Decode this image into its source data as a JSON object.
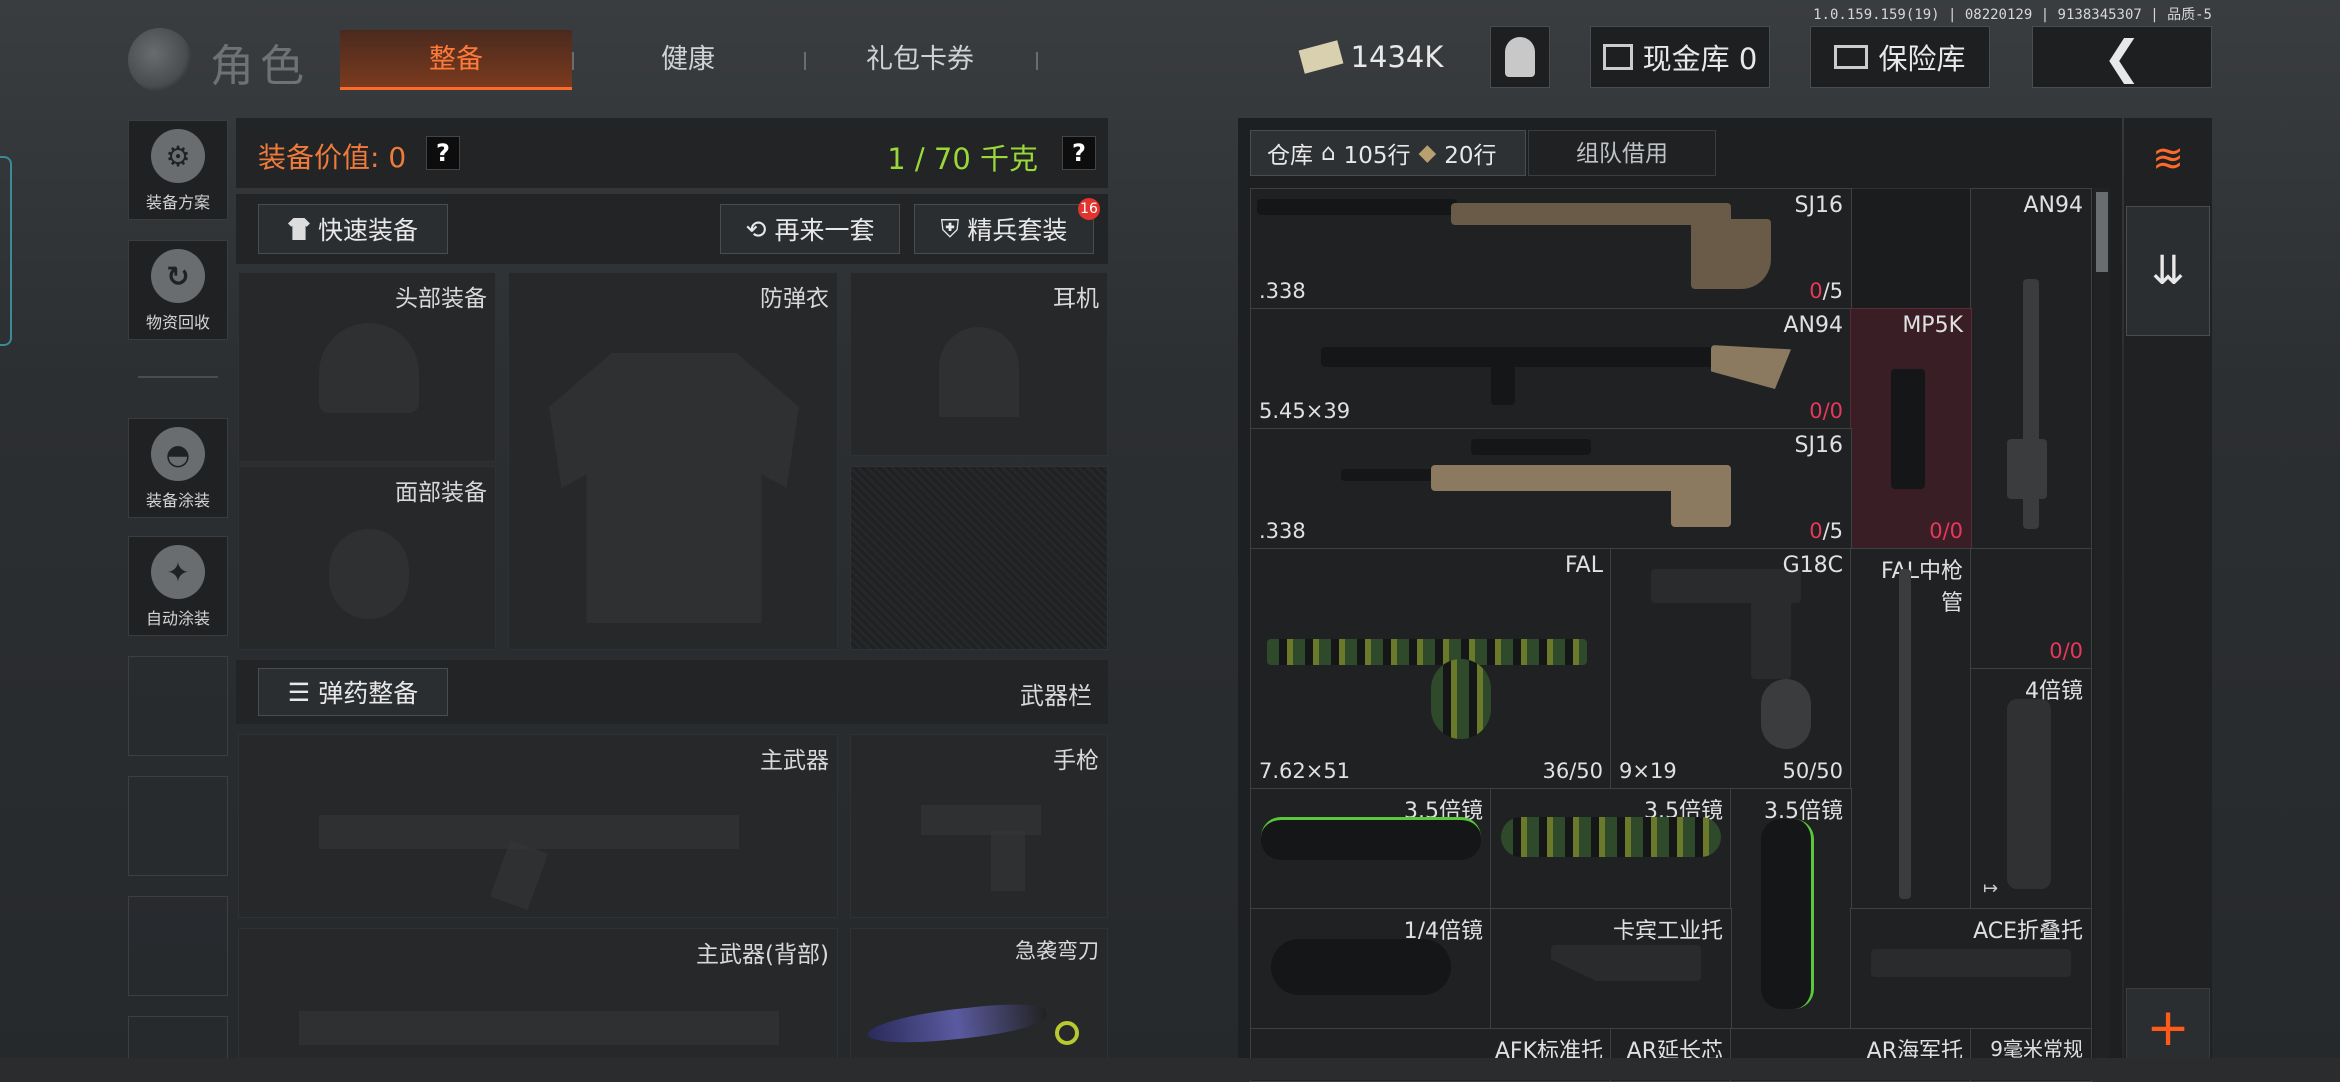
{
  "header": {
    "version": "1.0.159.159(19) | 08220129 | 9138345307 | 品质-5",
    "title": "角色",
    "tabs": [
      {
        "label": "整备",
        "active": true
      },
      {
        "label": "健康"
      },
      {
        "label": "礼包卡券"
      }
    ],
    "money": "1434K",
    "cash_vault": "现金库 0",
    "safe_box": "保险库",
    "icons": {
      "money": "cash-icon",
      "profile": "operator-icon",
      "cash_vault": "vault-icon",
      "safe_box": "safebox-icon",
      "back": "back-arrow-icon"
    }
  },
  "sidebar": {
    "items": [
      {
        "label": "装备方案",
        "icon": "loadout-plan-icon"
      },
      {
        "label": "物资回收",
        "icon": "recycle-icon"
      },
      {
        "label": "装备涂装",
        "icon": "helmet-paint-icon"
      },
      {
        "label": "自动涂装",
        "icon": "auto-paint-icon"
      }
    ]
  },
  "loadout": {
    "value_label": "装备价值: 0",
    "weight": "1 / 70 千克",
    "quick_equip": "快速装备",
    "again": "再来一套",
    "elite": "精兵套装",
    "elite_badge": "16",
    "slots": {
      "head": "头部装备",
      "armor": "防弹衣",
      "headset": "耳机",
      "face": "面部装备",
      "ammo_btn": "弹药整备",
      "weapons_bar": "武器栏",
      "primary": "主武器",
      "pistol": "手枪",
      "primary_back": "主武器(背部)",
      "knife": "急袭弯刀"
    }
  },
  "warehouse": {
    "tab_label": "仓库",
    "rows_home": "105行",
    "rows_bag": "20行",
    "team_borrow": "组队借用",
    "items": [
      {
        "id": "sj16a",
        "name": "SJ16",
        "cal": ".338",
        "count": "0/5",
        "count_red": "0"
      },
      {
        "id": "an94top",
        "name": "AN94"
      },
      {
        "id": "an94",
        "name": "AN94",
        "cal": "5.45×39",
        "count": "0/0",
        "count_red": "0/0"
      },
      {
        "id": "mp5k",
        "name": "MP5K",
        "count": "0/0",
        "count_red": "0/0"
      },
      {
        "id": "sj16b",
        "name": "SJ16",
        "cal": ".338",
        "count": "0/5",
        "count_red": "0"
      },
      {
        "id": "fal",
        "name": "FAL",
        "cal": "7.62×51",
        "count": "36/50"
      },
      {
        "id": "g18c",
        "name": "G18C",
        "cal": "9×19",
        "count": "50/50"
      },
      {
        "id": "falbarrel",
        "name": "FAL中枪\n管"
      },
      {
        "id": "misc0",
        "count": "0/0",
        "count_red": "0/0"
      },
      {
        "id": "scope4x",
        "name": "4倍镜"
      },
      {
        "id": "scope35a",
        "name": "3.5倍镜"
      },
      {
        "id": "scope35b",
        "name": "3.5倍镜"
      },
      {
        "id": "scope35c",
        "name": "3.5倍镜"
      },
      {
        "id": "scope14",
        "name": "1/4倍镜"
      },
      {
        "id": "stock_kb",
        "name": "卡宾工业托"
      },
      {
        "id": "stock_ace",
        "name": "ACE折叠托"
      },
      {
        "id": "afk",
        "name": "AFK标准托"
      },
      {
        "id": "ar_ext",
        "name": "AR延长芯"
      },
      {
        "id": "ar_navy",
        "name": "AR海军托"
      },
      {
        "id": "bar9",
        "name": "9毫米常规"
      }
    ]
  },
  "right_tools": {
    "icons": [
      "stack-refresh-icon",
      "stack-download-icon",
      "plus-icon"
    ]
  }
}
